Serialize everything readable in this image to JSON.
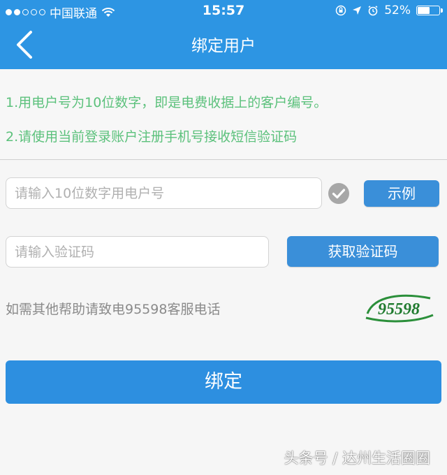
{
  "status_bar": {
    "carrier": "中国联通",
    "time": "15:57",
    "battery_text": "52%",
    "battery_level": 0.52
  },
  "nav": {
    "title": "绑定用户",
    "back_icon": "chevron-left-icon"
  },
  "notes": {
    "line1": "1.用电户号为10位数字，即是电费收据上的客户编号。",
    "line2": "2.请使用当前登录账户注册手机号接收短信验证码"
  },
  "form": {
    "account_placeholder": "请输入10位数字用电户号",
    "account_value": "",
    "example_button": "示例",
    "code_placeholder": "请输入验证码",
    "code_value": "",
    "get_code_button": "获取验证码"
  },
  "help": {
    "text": "如需其他帮助请致电95598客服电话",
    "logo_number": "95598"
  },
  "bind_button": "绑定",
  "watermark": "头条号 / 达州生活圈圈",
  "colors": {
    "header_blue": "#2d95e3",
    "button_blue": "#3a8fd9",
    "note_green": "#5cc17c",
    "help_gray": "#8a8a8a"
  }
}
